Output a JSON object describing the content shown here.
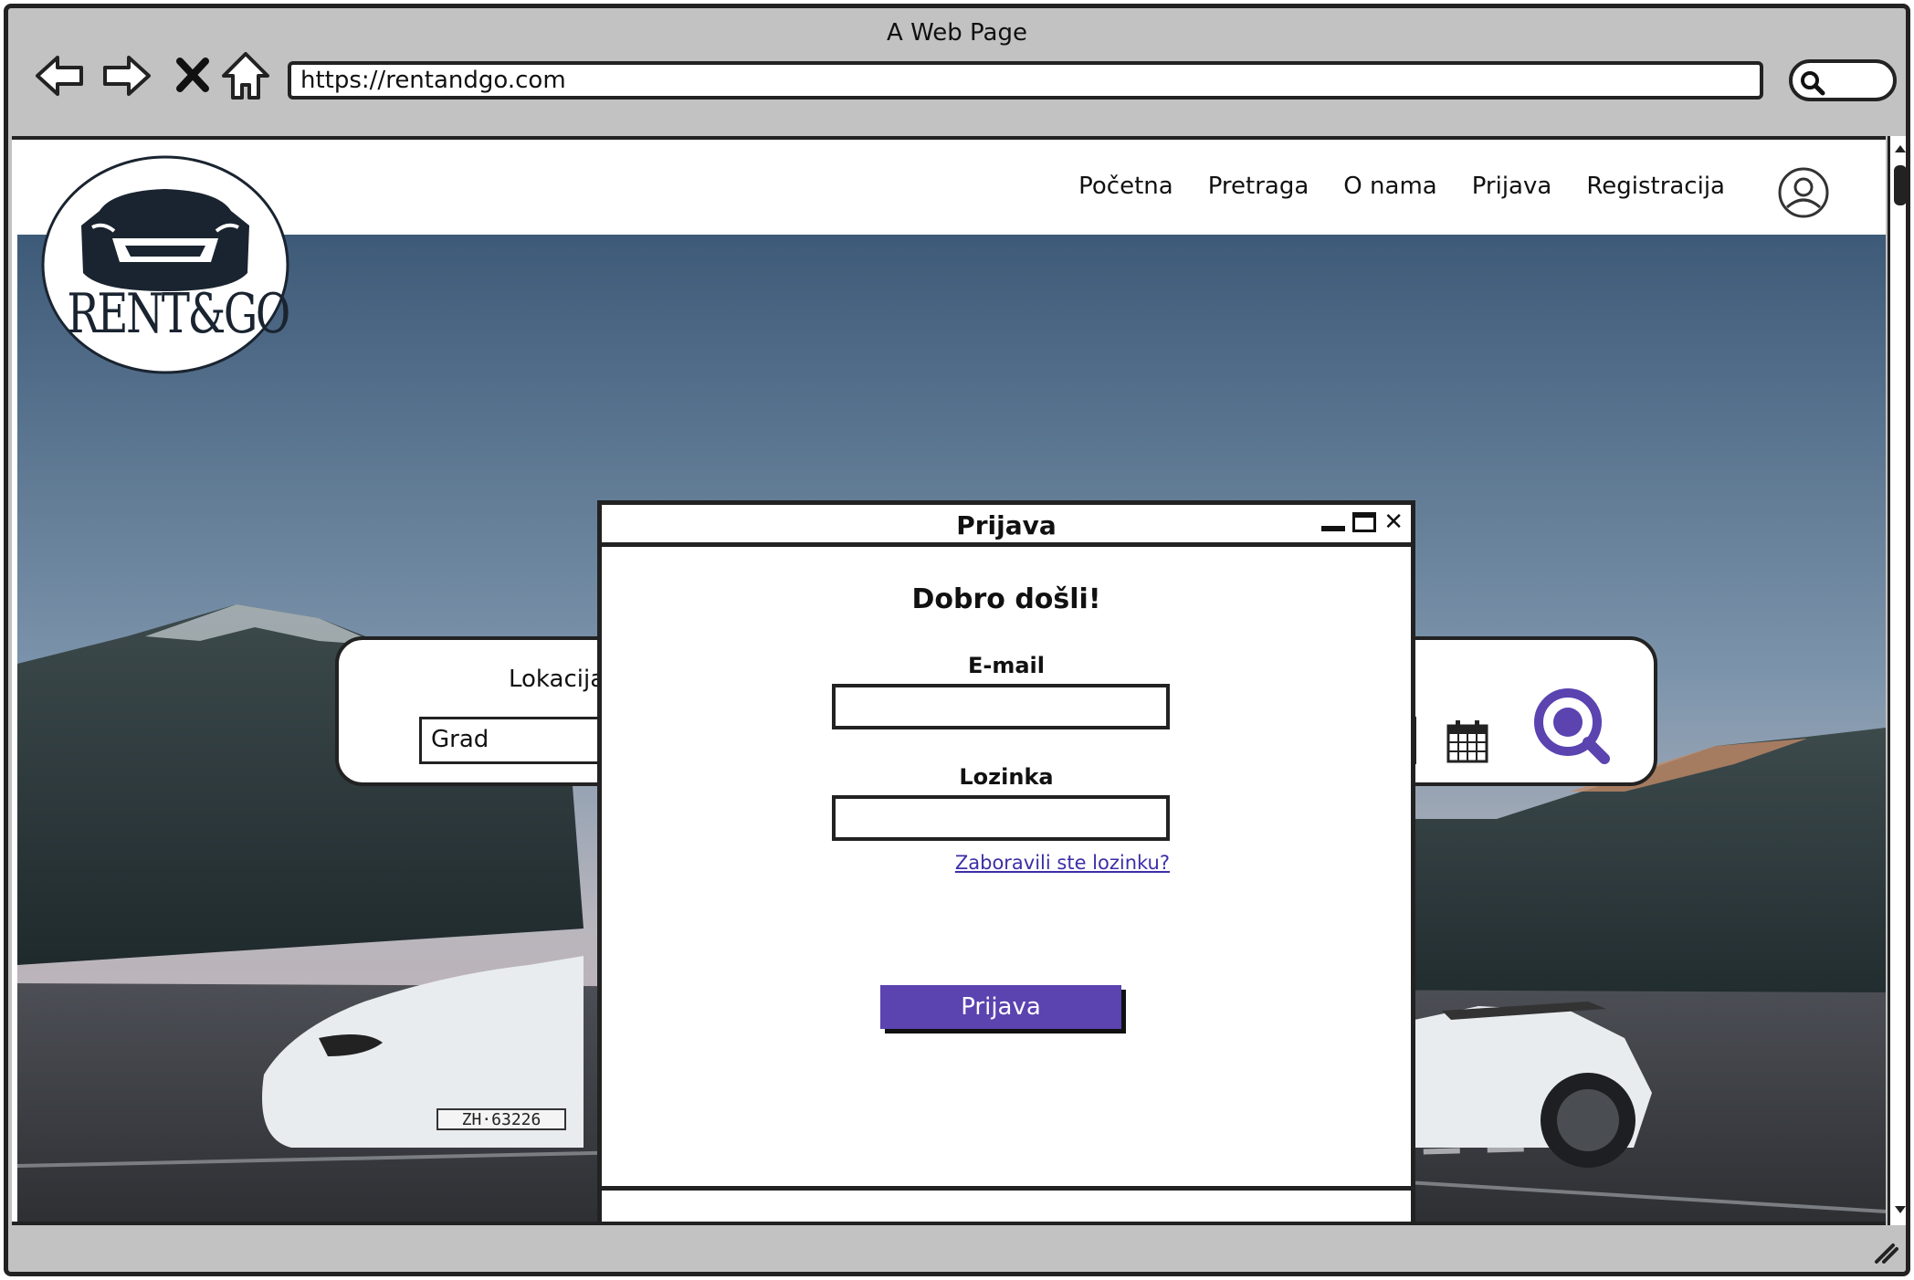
{
  "browser": {
    "title": "A Web Page",
    "url": "https://rentandgo.com"
  },
  "logo": {
    "text": "RENT&GO"
  },
  "nav": {
    "items": [
      "Početna",
      "Pretraga",
      "O nama",
      "Prijava",
      "Registracija"
    ]
  },
  "search": {
    "location_label": "Lokacija",
    "city_value": "Grad"
  },
  "modal": {
    "title": "Prijava",
    "welcome": "Dobro došli!",
    "email_label": "E-mail",
    "password_label": "Lozinka",
    "forgot_link": "Zaboravili ste lozinku?",
    "submit_label": "Prijava"
  },
  "colors": {
    "accent": "#5b43b0",
    "link": "#3c2fa8"
  }
}
